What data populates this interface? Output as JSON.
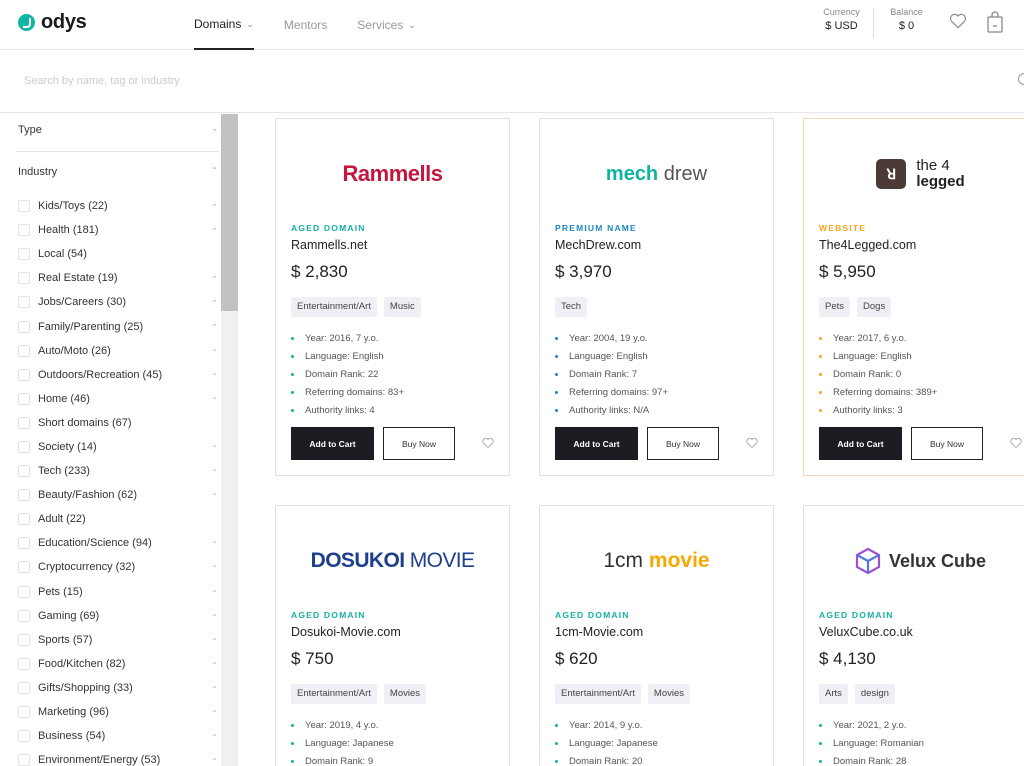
{
  "header": {
    "logo": "odys",
    "nav": [
      {
        "label": "Domains",
        "has_dropdown": true,
        "active": true
      },
      {
        "label": "Mentors",
        "has_dropdown": false,
        "active": false
      },
      {
        "label": "Services",
        "has_dropdown": true,
        "active": false
      }
    ],
    "currency_label": "Currency",
    "currency_value": "$ USD",
    "balance_label": "Balance",
    "balance_value": "$ 0"
  },
  "search": {
    "placeholder": "Search by name, tag or industry",
    "value": ""
  },
  "sidebar": {
    "type_label": "Type",
    "industry_label": "Industry",
    "industries": [
      {
        "label": "Kids/Toys (22)",
        "expandable": true
      },
      {
        "label": "Health (181)",
        "expandable": true
      },
      {
        "label": "Local (54)",
        "expandable": false
      },
      {
        "label": "Real Estate (19)",
        "expandable": true
      },
      {
        "label": "Jobs/Careers (30)",
        "expandable": true
      },
      {
        "label": "Family/Parenting (25)",
        "expandable": true
      },
      {
        "label": "Auto/Moto (26)",
        "expandable": true
      },
      {
        "label": "Outdoors/Recreation (45)",
        "expandable": true
      },
      {
        "label": "Home (46)",
        "expandable": true
      },
      {
        "label": "Short domains (67)",
        "expandable": false
      },
      {
        "label": "Society (14)",
        "expandable": true
      },
      {
        "label": "Tech (233)",
        "expandable": true
      },
      {
        "label": "Beauty/Fashion (62)",
        "expandable": true
      },
      {
        "label": "Adult (22)",
        "expandable": false
      },
      {
        "label": "Education/Science (94)",
        "expandable": true
      },
      {
        "label": "Cryptocurrency (32)",
        "expandable": true
      },
      {
        "label": "Pets (15)",
        "expandable": true
      },
      {
        "label": "Gaming (69)",
        "expandable": true
      },
      {
        "label": "Sports (57)",
        "expandable": true
      },
      {
        "label": "Food/Kitchen (82)",
        "expandable": true
      },
      {
        "label": "Gifts/Shopping (33)",
        "expandable": true
      },
      {
        "label": "Marketing (96)",
        "expandable": true
      },
      {
        "label": "Business (54)",
        "expandable": true
      },
      {
        "label": "Environment/Energy (53)",
        "expandable": true
      }
    ]
  },
  "colors": {
    "aged": "#14b0a2",
    "premium": "#1f88c2",
    "website": "#f5a623"
  },
  "cards": [
    {
      "logo": "Rammells",
      "type": "AGED DOMAIN",
      "type_color": "#14b0a2",
      "name": "Rammells.net",
      "price": "$ 2,830",
      "tags": [
        "Entertainment/Art",
        "Music"
      ],
      "facts": [
        "Year: 2016, 7 y.o.",
        "Language: English",
        "Domain Rank: 22",
        "Referring domains: 83+",
        "Authority links: 4"
      ],
      "add_label": "Add to Cart",
      "buy_label": "Buy Now"
    },
    {
      "logo_a": "mech",
      "logo_b": "drew",
      "type": "PREMIUM NAME",
      "type_color": "#1f88c2",
      "name": "MechDrew.com",
      "price": "$ 3,970",
      "tags": [
        "Tech"
      ],
      "facts": [
        "Year: 2004, 19 y.o.",
        "Language: English",
        "Domain Rank: 7",
        "Referring domains: 97+",
        "Authority links: N/A"
      ],
      "add_label": "Add to Cart",
      "buy_label": "Buy Now"
    },
    {
      "logo_a": "the 4",
      "logo_b": "legged",
      "type": "WEBSITE",
      "type_color": "#f5a623",
      "name": "The4Legged.com",
      "price": "$ 5,950",
      "tags": [
        "Pets",
        "Dogs"
      ],
      "facts": [
        "Year: 2017, 6 y.o.",
        "Language: English",
        "Domain Rank: 0",
        "Referring domains: 389+",
        "Authority links: 3"
      ],
      "add_label": "Add to Cart",
      "buy_label": "Buy Now"
    },
    {
      "logo_a": "DOSUKOI",
      "logo_b": "MOVIE",
      "type": "AGED DOMAIN",
      "type_color": "#14b0a2",
      "name": "Dosukoi-Movie.com",
      "price": "$ 750",
      "tags": [
        "Entertainment/Art",
        "Movies"
      ],
      "facts": [
        "Year: 2019, 4 y.o.",
        "Language: Japanese",
        "Domain Rank: 9"
      ]
    },
    {
      "logo_a": "1cm",
      "logo_b": "movie",
      "type": "AGED DOMAIN",
      "type_color": "#14b0a2",
      "name": "1cm-Movie.com",
      "price": "$ 620",
      "tags": [
        "Entertainment/Art",
        "Movies"
      ],
      "facts": [
        "Year: 2014, 9 y.o.",
        "Language: Japanese",
        "Domain Rank: 20"
      ]
    },
    {
      "logo": "Velux Cube",
      "type": "AGED DOMAIN",
      "type_color": "#14b0a2",
      "name": "VeluxCube.co.uk",
      "price": "$ 4,130",
      "tags": [
        "Arts",
        "design"
      ],
      "facts": [
        "Year: 2021, 2 y.o.",
        "Language: Romanian",
        "Domain Rank: 28"
      ]
    }
  ]
}
